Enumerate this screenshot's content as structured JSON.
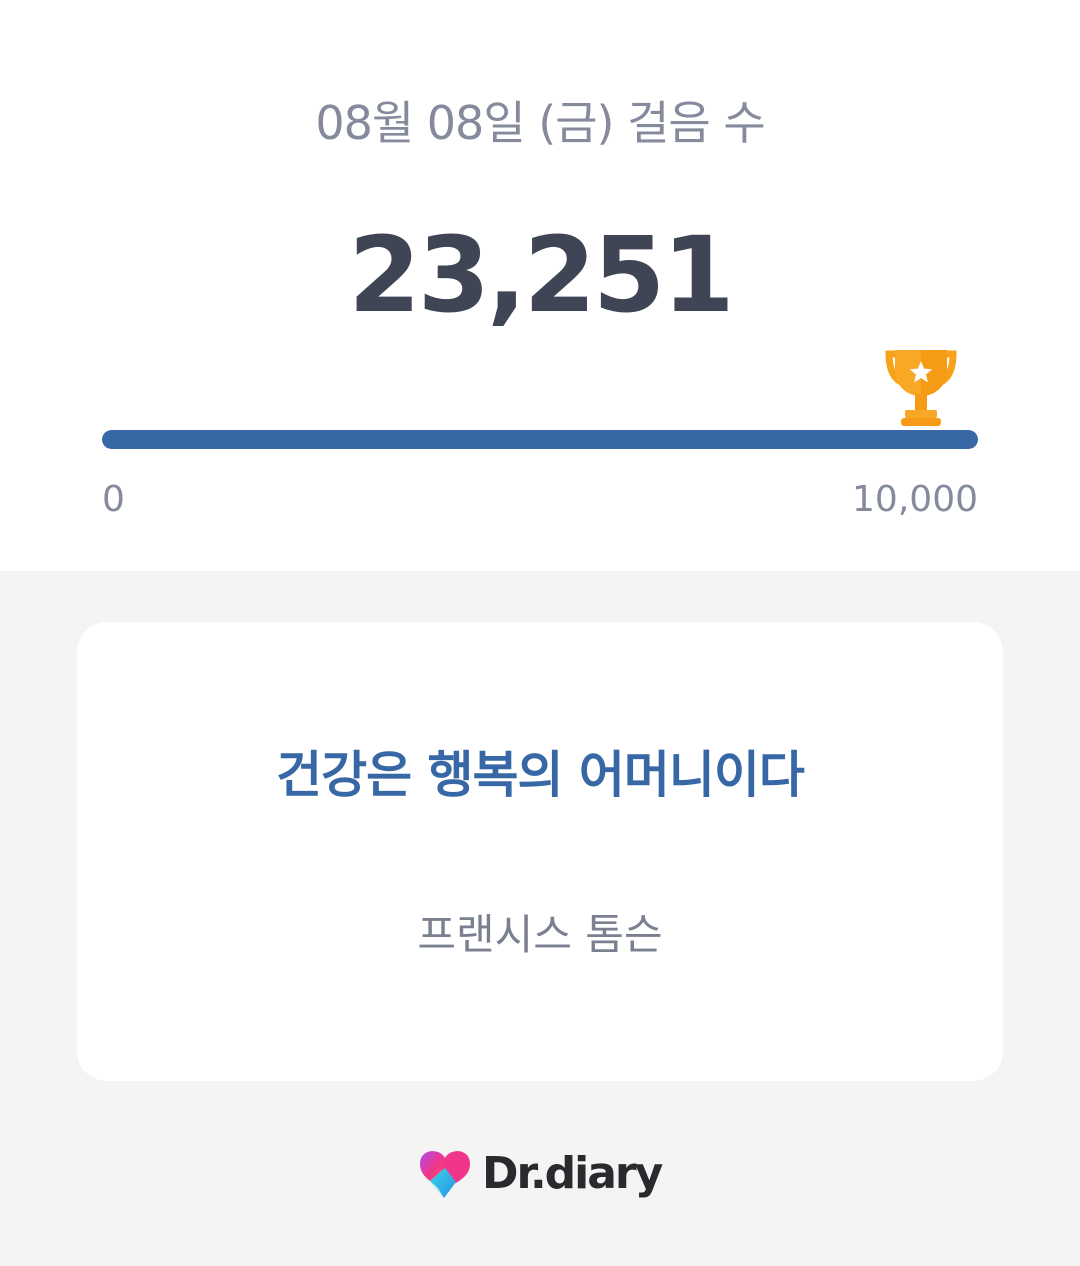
{
  "steps": {
    "title": "08월 08일 (금) 걸음 수",
    "count": "23,251",
    "progress_fraction": 1.0,
    "scale_min": "0",
    "scale_max": "10,000",
    "goal_icon": "trophy-icon",
    "progress_color": "#3767a5"
  },
  "quote": {
    "text": "건강은 행복의 어머니이다",
    "author": "프랜시스 톰슨",
    "text_color": "#3767a5"
  },
  "brand": {
    "name": "Dr.diary",
    "logo_icon": "heart-logo-icon"
  }
}
